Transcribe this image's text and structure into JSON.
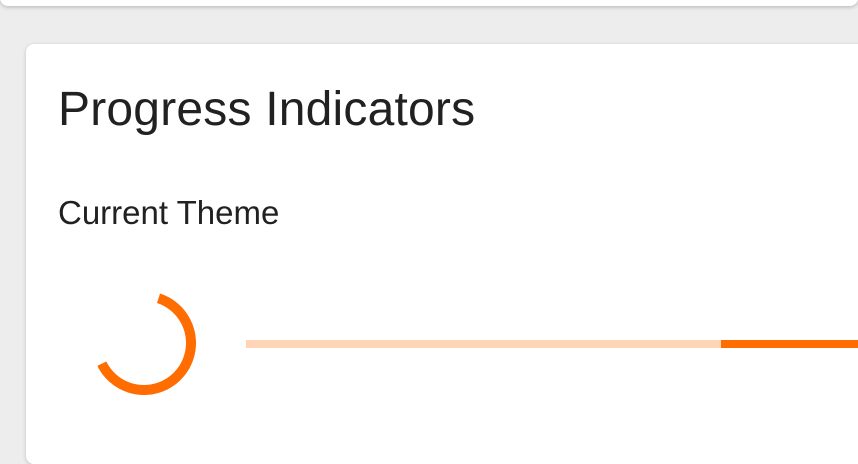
{
  "card": {
    "title": "Progress Indicators",
    "section_title": "Current Theme"
  },
  "theme": {
    "accent_color": "#ff6d00",
    "track_color": "#ffd5b8"
  },
  "indicators": {
    "circular": {
      "type": "indeterminate",
      "icon": "spinner-icon"
    },
    "linear": {
      "type": "indeterminate"
    }
  }
}
